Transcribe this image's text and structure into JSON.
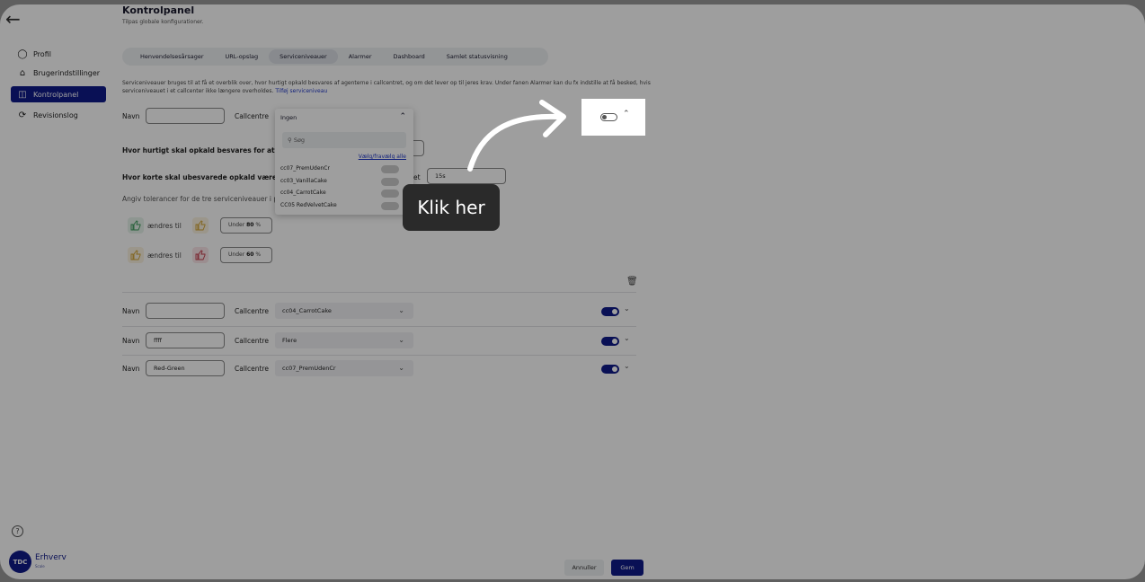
{
  "sidebar": {
    "items": [
      {
        "label": "Profil",
        "icon": "user-icon"
      },
      {
        "label": "Brugerindstillinger",
        "icon": "home-icon"
      },
      {
        "label": "Kontrolpanel",
        "icon": "panel-icon",
        "active": true
      },
      {
        "label": "Revisionslog",
        "icon": "refresh-icon"
      }
    ],
    "help": "?",
    "logo": {
      "badge": "TDC",
      "name": "Erhverv",
      "tagline": "Scale"
    }
  },
  "header": {
    "title": "Kontrolpanel",
    "subtitle": "Tilpas globale konfigurationer."
  },
  "tabs": [
    {
      "label": "Henvendelsesårsager"
    },
    {
      "label": "URL-opslag"
    },
    {
      "label": "Serviceniveauer",
      "active": true
    },
    {
      "label": "Alarmer"
    },
    {
      "label": "Dashboard"
    },
    {
      "label": "Samlet statusvisning"
    }
  ],
  "description": {
    "text": "Serviceniveauer bruges til at få et overblik over, hvor hurtigt opkald besvares af agenterne i callcentret, og om det lever op til jeres krav. Under fanen Alarmer kan du fx indstille at få besked, hvis serviceniveauet i et callcenter ikke længere overholdes.",
    "link": "Tilføj serviceniveau"
  },
  "form": {
    "name_label": "Navn",
    "callcentre_label": "Callcentre",
    "name_value": "",
    "callcentre_value": "Ingen",
    "q1": "Hvor hurtigt skal opkald besvares for at overho",
    "q2": "Hvor korte skal ubesvarede opkald være, før de",
    "q2_suffix": "et",
    "q2_value": "15s",
    "tolerance_hint": "Angiv tolerancer for de tre serviceniveauer i pr",
    "changes_to": "ændres til",
    "tol1": {
      "prefix": "Under",
      "value": "80",
      "unit": "%"
    },
    "tol2": {
      "prefix": "Under",
      "value": "60",
      "unit": "%"
    }
  },
  "dropdown": {
    "selected": "Ingen",
    "search_placeholder": "Søg",
    "select_all": "Vælg/fravælg alle",
    "options": [
      "cc07_PremUdenCr",
      "cc03_VanillaCake",
      "cc04_CarrotCake",
      "CC05 RedVelvetCake"
    ]
  },
  "rows": [
    {
      "name_label": "Navn",
      "name": "",
      "callcentre_label": "Callcentre",
      "callcentre": "cc04_CarrotCake"
    },
    {
      "name_label": "Navn",
      "name": "ffff",
      "callcentre_label": "Callcentre",
      "callcentre": "Flere"
    },
    {
      "name_label": "Navn",
      "name": "Red-Green",
      "callcentre_label": "Callcentre",
      "callcentre": "cc07_PremUdenCr"
    }
  ],
  "footer": {
    "cancel": "Annuller",
    "save": "Gem"
  },
  "tutorial": {
    "tooltip": "Klik her"
  },
  "colors": {
    "accent": "#101a8a",
    "link": "#2037c8"
  }
}
